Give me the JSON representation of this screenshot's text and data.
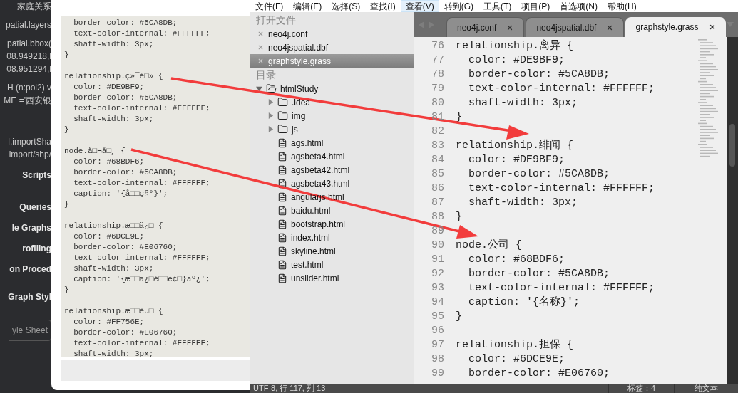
{
  "background_panel": {
    "lines": [
      {
        "text": "家庭关系",
        "kind": "plain"
      },
      {
        "text": "patial.layers",
        "kind": "plain"
      },
      {
        "text": "patial.bbox(",
        "kind": "plain"
      },
      {
        "text": "08.949218,l",
        "kind": "plain"
      },
      {
        "text": "08.951294,l",
        "kind": "plain"
      },
      {
        "text": "H (n:poi2) v",
        "kind": "plain"
      },
      {
        "text": "ME ='西安银",
        "kind": "plain"
      },
      {
        "text": "l.importSha",
        "kind": "plain"
      },
      {
        "text": "import/shp/",
        "kind": "plain"
      },
      {
        "text": "Scripts",
        "kind": "heading"
      },
      {
        "text": "Queries",
        "kind": "nav"
      },
      {
        "text": "le Graphs",
        "kind": "nav"
      },
      {
        "text": "rofiling",
        "kind": "nav"
      },
      {
        "text": "on Proced",
        "kind": "nav"
      },
      {
        "text": "Graph Styl",
        "kind": "nav"
      }
    ],
    "button": "yle Sheet"
  },
  "dialog": {
    "code_blocks": [
      {
        "lines": [
          "  border-color: #5CA8DB;",
          "  text-color-internal: #FFFFFF;",
          "  shaft-width: 3px;",
          "}"
        ]
      },
      {
        "lines": [
          "relationship.ç»¯é□» {",
          "  color: #DE9BF9;",
          "  border-color: #5CA8DB;",
          "  text-color-internal: #FFFFFF;",
          "  shaft-width: 3px;",
          "}"
        ]
      },
      {
        "lines": [
          "node.å□¬å□¸ {",
          "  color: #68BDF6;",
          "  border-color: #5CA8DB;",
          "  text-color-internal: #FFFFFF;",
          "  caption: '{å□□ç§°}';",
          "}"
        ]
      },
      {
        "lines": [
          "relationship.æ□□ä¿□ {",
          "  color: #6DCE9E;",
          "  border-color: #E06760;",
          "  text-color-internal: #FFFFFF;",
          "  shaft-width: 3px;",
          "  caption: '{æ□□ä¿□é□□é¢□}äº¿';",
          "}"
        ]
      },
      {
        "lines": [
          "relationship.æ□□èµ□ {",
          "  color: #FF756E;",
          "  border-color: #E06760;",
          "  text-color-internal: #FFFFFF;",
          "  shaft-width: 3px;"
        ]
      }
    ]
  },
  "menu_bar": [
    {
      "label": "文件(F)",
      "selected": false
    },
    {
      "label": "编辑(E)",
      "selected": false
    },
    {
      "label": "选择(S)",
      "selected": false
    },
    {
      "label": "查找(I)",
      "selected": false
    },
    {
      "label": "查看(V)",
      "selected": true
    },
    {
      "label": "转到(G)",
      "selected": false
    },
    {
      "label": "工具(T)",
      "selected": false
    },
    {
      "label": "项目(P)",
      "selected": false
    },
    {
      "label": "首选项(N)",
      "selected": false
    },
    {
      "label": "帮助(H)",
      "selected": false
    }
  ],
  "sidebar": {
    "open_files_title": "打开文件",
    "open_files": [
      {
        "name": "neo4j.conf",
        "selected": false
      },
      {
        "name": "neo4jspatial.dbf",
        "selected": false
      },
      {
        "name": "graphstyle.grass",
        "selected": true
      }
    ],
    "folders_title": "目录",
    "tree": [
      {
        "name": "htmlStudy",
        "kind": "folder",
        "expanded": true,
        "children": [
          {
            "name": ".idea",
            "kind": "folder",
            "expanded": false
          },
          {
            "name": "img",
            "kind": "folder",
            "expanded": false
          },
          {
            "name": "js",
            "kind": "folder",
            "expanded": false
          },
          {
            "name": "ags.html",
            "kind": "file"
          },
          {
            "name": "agsbeta4.html",
            "kind": "file"
          },
          {
            "name": "agsbeta42.html",
            "kind": "file"
          },
          {
            "name": "agsbeta43.html",
            "kind": "file"
          },
          {
            "name": "angularjs.html",
            "kind": "file"
          },
          {
            "name": "baidu.html",
            "kind": "file"
          },
          {
            "name": "bootstrap.html",
            "kind": "file"
          },
          {
            "name": "index.html",
            "kind": "file"
          },
          {
            "name": "skyline.html",
            "kind": "file"
          },
          {
            "name": "test.html",
            "kind": "file"
          },
          {
            "name": "unslider.html",
            "kind": "file"
          }
        ]
      }
    ]
  },
  "tabs": [
    {
      "label": "neo4j.conf",
      "selected": false
    },
    {
      "label": "neo4jspatial.dbf",
      "selected": false
    },
    {
      "label": "graphstyle.grass",
      "selected": true
    }
  ],
  "editor": {
    "lines": [
      {
        "number": "76",
        "text": "relationship.离异 {"
      },
      {
        "number": "77",
        "text": "  color: #DE9BF9;"
      },
      {
        "number": "78",
        "text": "  border-color: #5CA8DB;"
      },
      {
        "number": "79",
        "text": "  text-color-internal: #FFFFFF;"
      },
      {
        "number": "80",
        "text": "  shaft-width: 3px;"
      },
      {
        "number": "81",
        "text": "}"
      },
      {
        "number": "82"
      },
      {
        "number": "83",
        "text": "relationship.绯闻 {"
      },
      {
        "number": "84",
        "text": "  color: #DE9BF9;"
      },
      {
        "number": "85",
        "text": "  border-color: #5CA8DB;"
      },
      {
        "number": "86",
        "text": "  text-color-internal: #FFFFFF;"
      },
      {
        "number": "87",
        "text": "  shaft-width: 3px;"
      },
      {
        "number": "88",
        "text": "}"
      },
      {
        "number": "89"
      },
      {
        "number": "90",
        "text": "node.公司 {"
      },
      {
        "number": "91",
        "text": "  color: #68BDF6;"
      },
      {
        "number": "92",
        "text": "  border-color: #5CA8DB;"
      },
      {
        "number": "93",
        "text": "  text-color-internal: #FFFFFF;"
      },
      {
        "number": "94",
        "text": "  caption: '{名称}';"
      },
      {
        "number": "95",
        "text": "}"
      },
      {
        "number": "96"
      },
      {
        "number": "97",
        "text": "relationship.担保 {"
      },
      {
        "number": "98",
        "text": "  color: #6DCE9E;"
      },
      {
        "number": "99",
        "text": "  border-color: #E06760;"
      }
    ]
  },
  "status_bar": {
    "position": "UTF-8, 行 117, 列 13",
    "tab_size": "标签：4",
    "syntax": "纯文本"
  }
}
